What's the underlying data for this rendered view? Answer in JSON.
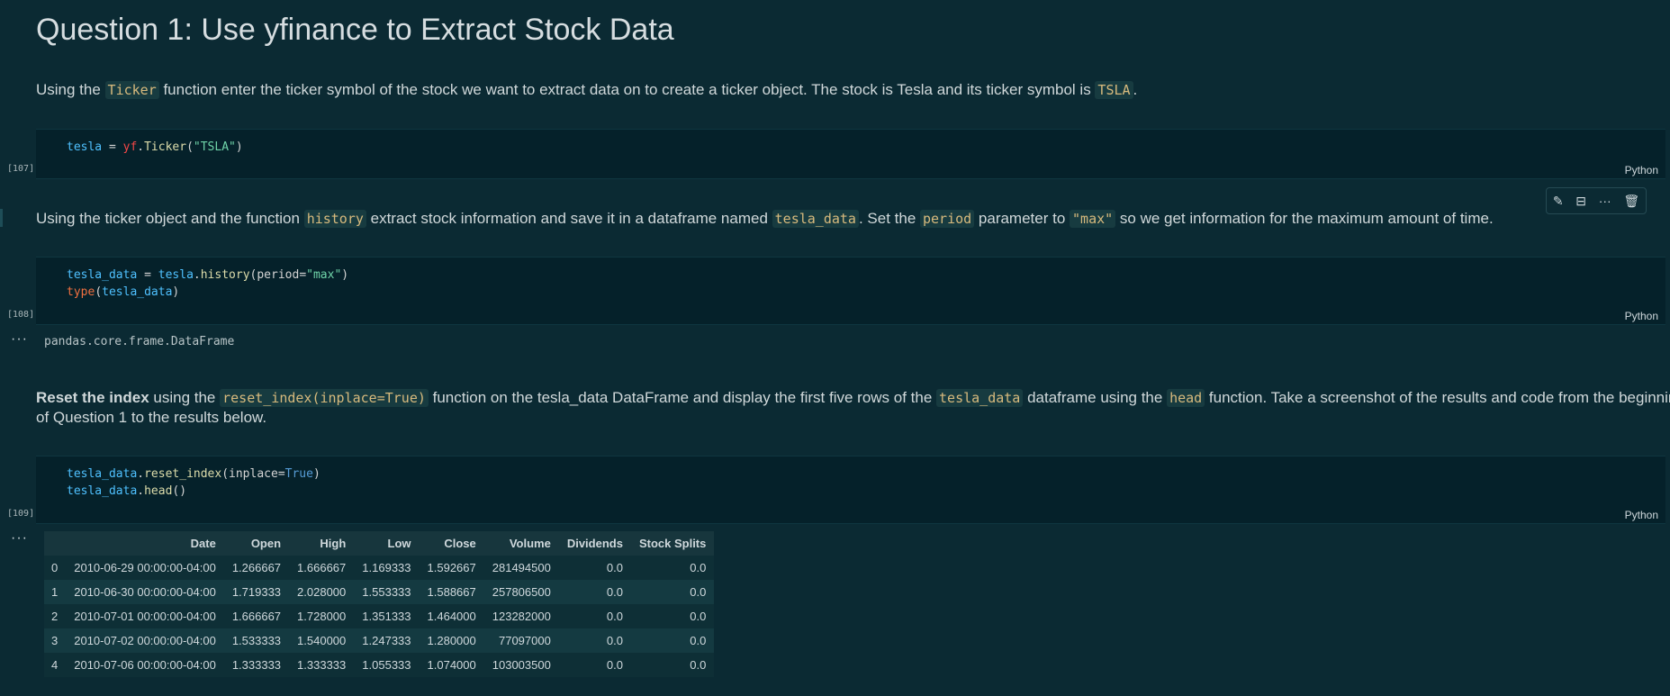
{
  "heading": "Question 1: Use yfinance to Extract Stock Data",
  "p1": {
    "t1": "Using the ",
    "c1": "Ticker",
    "t2": " function enter the ticker symbol of the stock we want to extract data on to create a ticker object. The stock is Tesla and its ticker symbol is ",
    "c2": "TSLA",
    "t3": "."
  },
  "cell1": {
    "exec": "[107]",
    "lang": "Python",
    "v1": "tesla",
    "op": " = ",
    "mod": "yf",
    "dot": ".",
    "fn": "Ticker",
    "lp": "(",
    "str": "\"TSLA\"",
    "rp": ")"
  },
  "p2": {
    "t1": "Using the ticker object and the function ",
    "c1": "history",
    "t2": " extract stock information and save it in a dataframe named ",
    "c2": "tesla_data",
    "t3": ". Set the ",
    "c3": "period",
    "t4": " parameter to ",
    "c4": "\"max\"",
    "t5": " so we get information for the maximum amount of time."
  },
  "cell2": {
    "exec": "[108]",
    "lang": "Python",
    "l1_v1": "tesla_data",
    "l1_op": " = ",
    "l1_v2": "tesla",
    "l1_dot": ".",
    "l1_fn": "history",
    "l1_lp": "(",
    "l1_param": "period",
    "l1_eq": "=",
    "l1_str": "\"max\"",
    "l1_rp": ")",
    "l2_fn": "type",
    "l2_lp": "(",
    "l2_v": "tesla_data",
    "l2_rp": ")",
    "output": "pandas.core.frame.DataFrame"
  },
  "p3": {
    "bold": "Reset the index",
    "t1": " using the ",
    "c1": "reset_index(inplace=True)",
    "t2": " function on the tesla_data DataFrame and display the first five rows of the ",
    "c2": "tesla_data",
    "t3": " dataframe using the ",
    "c3": "head",
    "t4": " function. Take a screenshot of the results and code from the beginning",
    "line2": "of Question 1 to the results below."
  },
  "cell3": {
    "exec": "[109]",
    "lang": "Python",
    "l1_v": "tesla_data",
    "l1_dot": ".",
    "l1_fn": "reset_index",
    "l1_lp": "(",
    "l1_param": "inplace",
    "l1_eq": "=",
    "l1_val": "True",
    "l1_rp": ")",
    "l2_v": "tesla_data",
    "l2_dot": ".",
    "l2_fn": "head",
    "l2_p": "()"
  },
  "output_dots": "···",
  "toolbar": {
    "edit_icon": "pencil-icon",
    "split_icon": "split-icon",
    "more_icon": "more-icon",
    "delete_icon": "trash-icon"
  },
  "table": {
    "headers": [
      "",
      "Date",
      "Open",
      "High",
      "Low",
      "Close",
      "Volume",
      "Dividends",
      "Stock Splits"
    ],
    "rows": [
      [
        "0",
        "2010-06-29 00:00:00-04:00",
        "1.266667",
        "1.666667",
        "1.169333",
        "1.592667",
        "281494500",
        "0.0",
        "0.0"
      ],
      [
        "1",
        "2010-06-30 00:00:00-04:00",
        "1.719333",
        "2.028000",
        "1.553333",
        "1.588667",
        "257806500",
        "0.0",
        "0.0"
      ],
      [
        "2",
        "2010-07-01 00:00:00-04:00",
        "1.666667",
        "1.728000",
        "1.351333",
        "1.464000",
        "123282000",
        "0.0",
        "0.0"
      ],
      [
        "3",
        "2010-07-02 00:00:00-04:00",
        "1.533333",
        "1.540000",
        "1.247333",
        "1.280000",
        "77097000",
        "0.0",
        "0.0"
      ],
      [
        "4",
        "2010-07-06 00:00:00-04:00",
        "1.333333",
        "1.333333",
        "1.055333",
        "1.074000",
        "103003500",
        "0.0",
        "0.0"
      ]
    ]
  },
  "colors": {
    "background": "#0b2a33",
    "cell_background": "#05212a",
    "inline_code": "#d7ba7d"
  }
}
